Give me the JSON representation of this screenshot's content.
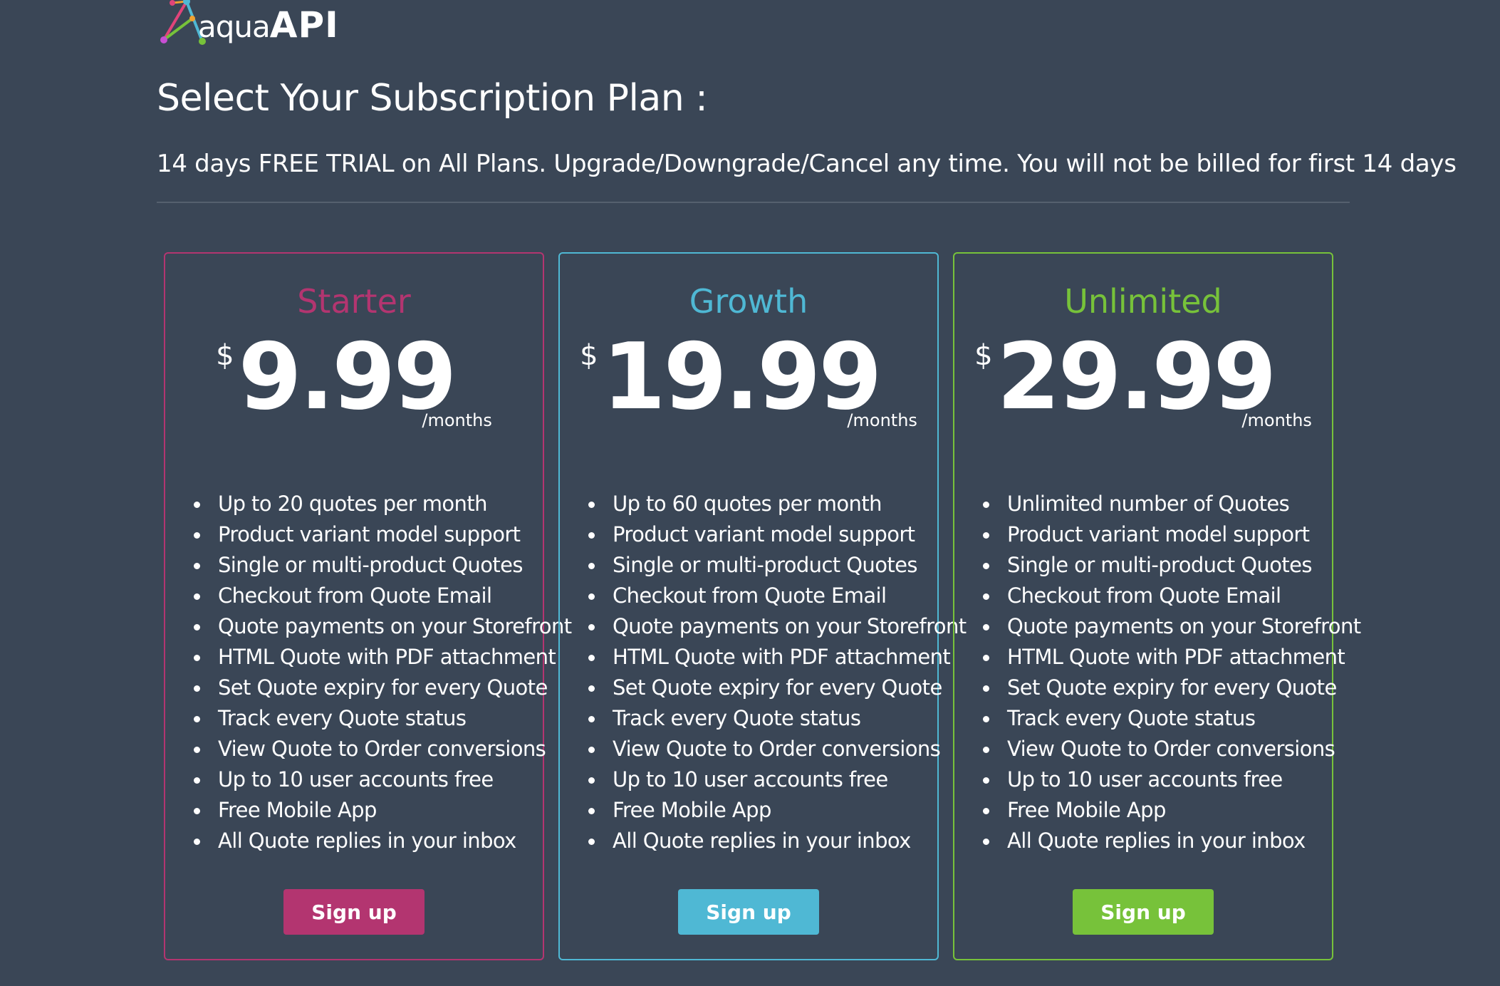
{
  "logo": {
    "text_light": "aqua",
    "text_bold": "API",
    "brand_mark": "network-triangle-icon"
  },
  "page_title": "Select Your Subscription Plan :",
  "subtitle": "14 days FREE TRIAL on All Plans. Upgrade/Downgrade/Cancel any time. You will not be billed for first 14 days",
  "plans": [
    {
      "name": "Starter",
      "accent": "#b33570",
      "currency": "$",
      "amount": "9.99",
      "period": "/months",
      "features": [
        "Up to 20 quotes per month",
        "Product variant model support",
        "Single or multi-product Quotes",
        "Checkout from Quote Email",
        "Quote payments on your Storefront",
        "HTML Quote with PDF attachment",
        "Set Quote expiry for every Quote",
        "Track every Quote status",
        "View Quote to Order conversions",
        "Up to 10 user accounts free",
        "Free Mobile App",
        "All Quote replies in your inbox"
      ],
      "button_label": "Sign up"
    },
    {
      "name": "Growth",
      "accent": "#4fb8d4",
      "currency": "$",
      "amount": "19.99",
      "period": "/months",
      "features": [
        "Up to 60 quotes per month",
        "Product variant model support",
        "Single or multi-product Quotes",
        "Checkout from Quote Email",
        "Quote payments on your Storefront",
        "HTML Quote with PDF attachment",
        "Set Quote expiry for every Quote",
        "Track every Quote status",
        "View Quote to Order conversions",
        "Up to 10 user accounts free",
        "Free Mobile App",
        "All Quote replies in your inbox"
      ],
      "button_label": "Sign up"
    },
    {
      "name": "Unlimited",
      "accent": "#77c23a",
      "currency": "$",
      "amount": "29.99",
      "period": "/months",
      "features": [
        "Unlimited number of Quotes",
        "Product variant model support",
        "Single or multi-product Quotes",
        "Checkout from Quote Email",
        "Quote payments on your Storefront",
        "HTML Quote with PDF attachment",
        "Set Quote expiry for every Quote",
        "Track every Quote status",
        "View Quote to Order conversions",
        "Up to 10 user accounts free",
        "Free Mobile App",
        "All Quote replies in your inbox"
      ],
      "button_label": "Sign up"
    }
  ]
}
